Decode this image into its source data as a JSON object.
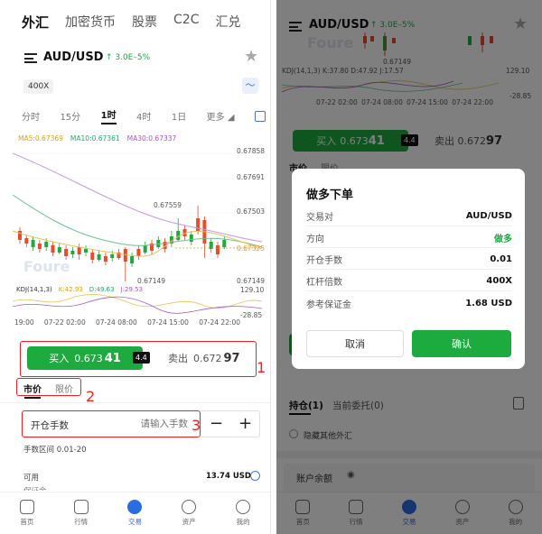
{
  "top_tabs": [
    "外汇",
    "加密货币",
    "股票",
    "C2C",
    "汇兑"
  ],
  "symbol": "AUD/USD",
  "change": "↑ 3.0E–5%",
  "leverage_badge": "400X",
  "timeframes": [
    "分时",
    "15分",
    "1时",
    "4时",
    "1日",
    "更多"
  ],
  "ma": {
    "ma5": "MA5:0.67369",
    "ma10": "MA10:0.67361",
    "ma30": "MA30:0.67337"
  },
  "price_axis": [
    "0.67858",
    "0.67691",
    "0.67503",
    "0.67325",
    "0.67149"
  ],
  "high_label": "0.67559",
  "low_label": "0.67149",
  "kdj": {
    "title": "KDJ(14,1,3)",
    "k": "K:42.93",
    "d": "D:49.63",
    "j": "J:29.53",
    "top": "129.10",
    "bottom": "-28.85"
  },
  "time_axis": [
    "19:00",
    "07-22 02:00",
    "07-24 08:00",
    "07-24 15:00",
    "07-24 22:00"
  ],
  "watermark": "Foure",
  "buy": {
    "label": "买入",
    "price_big": "0.673",
    "price_mid": "41"
  },
  "spread": "4.4",
  "sell": {
    "label": "卖出",
    "price_big": "0.672",
    "price_mid": "97"
  },
  "order_types": [
    "市价",
    "限价"
  ],
  "lots": {
    "label": "开仓手数",
    "placeholder": "请输入手数",
    "minus": "−",
    "plus": "+"
  },
  "range": "手数区间 0.01-20",
  "available": {
    "label": "可用",
    "value": "13.74 USD"
  },
  "margin_partial": "保证金",
  "bottom_tabs": [
    "首页",
    "行情",
    "交易",
    "资产",
    "我的"
  ],
  "annotations": [
    "1",
    "2",
    "3"
  ],
  "right": {
    "kdj_line": "KDJ(14,1,3)   K:37.80  D:47.92  J:17.57",
    "axis_top": "129.10",
    "axis_bottom": "-28.85",
    "price_labels": [
      "0.67149",
      "07-22 02:00",
      "07-24 08:00",
      "07-24 15:00",
      "07-24 22:00"
    ],
    "positions_tab": "持仓(1)",
    "pending_tab": "当前委托(0)",
    "hide_other": "隐藏其他外汇",
    "account_balance": "账户余额",
    "modal": {
      "title": "做多下单",
      "rows": [
        {
          "label": "交易对",
          "value": "AUD/USD"
        },
        {
          "label": "方向",
          "value": "做多"
        },
        {
          "label": "开仓手数",
          "value": "0.01"
        },
        {
          "label": "杠杆倍数",
          "value": "400X"
        },
        {
          "label": "参考保证金",
          "value": "1.68 USD"
        }
      ],
      "cancel": "取消",
      "confirm": "确认"
    }
  },
  "colors": {
    "green": "#1daa3f",
    "red": "#e94b2b",
    "blue": "#2a6de0"
  }
}
